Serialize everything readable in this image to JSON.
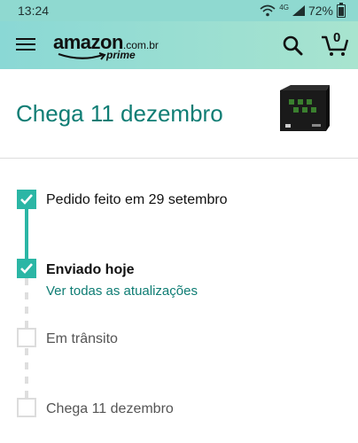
{
  "status_bar": {
    "time": "13:24",
    "network": "4G",
    "battery": "72%"
  },
  "header": {
    "logo_word": "amazon",
    "logo_domain": ".com.br",
    "logo_sub": "prime",
    "cart_count": "0"
  },
  "arrival": {
    "title": "Chega 11 dezembro"
  },
  "timeline": {
    "steps": [
      {
        "label": "Pedido feito em 29 setembro",
        "state": "done"
      },
      {
        "label": "Enviado hoje",
        "state": "done",
        "link": "Ver todas as atualizações"
      },
      {
        "label": "Em trânsito",
        "state": "pending"
      },
      {
        "label": "Chega 11 dezembro",
        "state": "pending"
      }
    ]
  },
  "colors": {
    "accent": "#0f7d74",
    "check": "#2bb6a5",
    "header_start": "#8ad8d5",
    "header_end": "#a8e4cf"
  }
}
